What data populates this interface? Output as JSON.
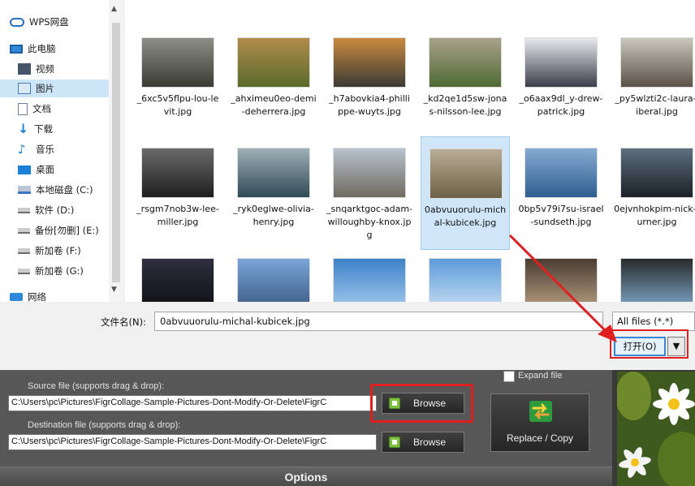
{
  "nav": {
    "items": [
      {
        "label": "WPS网盘",
        "icon": "cloud-icon"
      },
      {
        "label": "此电脑",
        "icon": "computer-icon"
      },
      {
        "label": "视频",
        "icon": "videos-folder-icon"
      },
      {
        "label": "图片",
        "icon": "pictures-folder-icon"
      },
      {
        "label": "文档",
        "icon": "documents-folder-icon"
      },
      {
        "label": "下载",
        "icon": "downloads-folder-icon"
      },
      {
        "label": "音乐",
        "icon": "music-folder-icon"
      },
      {
        "label": "桌面",
        "icon": "desktop-folder-icon"
      },
      {
        "label": "本地磁盘 (C:)",
        "icon": "system-drive-icon"
      },
      {
        "label": "软件 (D:)",
        "icon": "drive-icon"
      },
      {
        "label": "备份[勿删] (E:)",
        "icon": "drive-icon"
      },
      {
        "label": "新加卷 (F:)",
        "icon": "drive-icon"
      },
      {
        "label": "新加卷 (G:)",
        "icon": "drive-icon"
      },
      {
        "label": "网络",
        "icon": "network-icon"
      }
    ],
    "selected": "图片"
  },
  "files": [
    {
      "name": "_6xc5v5flpu-lou-levit.jpg",
      "colors": [
        "#8d8f86",
        "#3a3c33"
      ]
    },
    {
      "name": "_ahximeu0eo-demi-deherrera.jpg",
      "colors": [
        "#b08c4a",
        "#5a6a2c"
      ]
    },
    {
      "name": "_h7abovkia4-phillippe-wuyts.jpg",
      "colors": [
        "#c88a3e",
        "#3b3a35"
      ]
    },
    {
      "name": "_kd2qe1d5sw-jonas-nilsson-lee.jpg",
      "colors": [
        "#a8a28a",
        "#4f6a35"
      ]
    },
    {
      "name": "_o6aax9dl_y-drew-patrick.jpg",
      "colors": [
        "#e9e9ef",
        "#3a3f4a"
      ]
    },
    {
      "name": "_py5wlzti2c-laura-liberal.jpg",
      "colors": [
        "#c9c6bd",
        "#5a5247"
      ]
    },
    {
      "name": "_rsgm7nob3w-lee-miller.jpg",
      "colors": [
        "#6a6a6a",
        "#1e1e1e"
      ]
    },
    {
      "name": "_ryk0eglwe-olivia-henry.jpg",
      "colors": [
        "#9fb0b6",
        "#2f4a57"
      ]
    },
    {
      "name": "_snqarktgoc-adam-willoughby-knox.jpg",
      "colors": [
        "#b9c3cd",
        "#6f6a60"
      ]
    },
    {
      "name": "0abvuuorulu-michal-kubicek.jpg",
      "colors": [
        "#b8ad96",
        "#6d6146"
      ]
    },
    {
      "name": "0bp5v79i7su-israel-sundseth.jpg",
      "colors": [
        "#86abd3",
        "#2e5f8f"
      ]
    },
    {
      "name": "0ejvnhokpim-nick-turner.jpg",
      "colors": [
        "#5d6f7f",
        "#1c2026"
      ]
    },
    {
      "name": "",
      "colors": [
        "#2e2e3e",
        "#101015"
      ]
    },
    {
      "name": "",
      "colors": [
        "#7aa6d8",
        "#3d5d86"
      ]
    },
    {
      "name": "",
      "colors": [
        "#3e82c9",
        "#9dc7ec"
      ]
    },
    {
      "name": "",
      "colors": [
        "#5d9bd9",
        "#c0daf0"
      ]
    },
    {
      "name": "",
      "colors": [
        "#4a3d32",
        "#b29a7e"
      ]
    },
    {
      "name": "",
      "colors": [
        "#2a2a2a",
        "#7aa3c5"
      ]
    }
  ],
  "selected_file": "0abvuuorulu-michal-kubicek.jpg",
  "dialog": {
    "filename_label": "文件名(N):",
    "filename_value": "0abvuuorulu-michal-kubicek.jpg",
    "file_type": "All files (*.*)",
    "open_label": "打开(O)",
    "open_dropdown_glyph": "▼"
  },
  "app": {
    "source_label": "Source file (supports drag & drop):",
    "source_path": "C:\\Users\\pc\\Pictures\\FigrCollage-Sample-Pictures-Dont-Modify-Or-Delete\\FigrC",
    "destination_label": "Destination file (supports drag & drop):",
    "destination_path": "C:\\Users\\pc\\Pictures\\FigrCollage-Sample-Pictures-Dont-Modify-Or-Delete\\FigrC",
    "browse_label": "Browse",
    "expand_label": "Expand file",
    "replace_label": "Replace / Copy",
    "options_label": "Options"
  },
  "colors": {
    "selection": "#cde6f7",
    "accent": "#3a86d0",
    "annotation": "#e02020",
    "app_bg": "#575757"
  }
}
